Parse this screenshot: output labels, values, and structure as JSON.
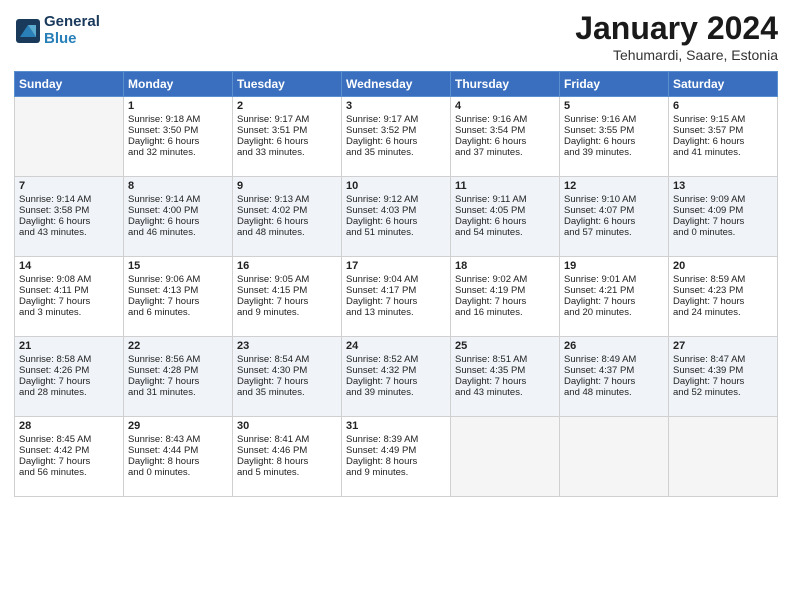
{
  "header": {
    "logo_line1": "General",
    "logo_line2": "Blue",
    "month_title": "January 2024",
    "location": "Tehumardi, Saare, Estonia"
  },
  "days_of_week": [
    "Sunday",
    "Monday",
    "Tuesday",
    "Wednesday",
    "Thursday",
    "Friday",
    "Saturday"
  ],
  "weeks": [
    [
      {
        "day": "",
        "empty": true
      },
      {
        "day": "1",
        "sunrise": "Sunrise: 9:18 AM",
        "sunset": "Sunset: 3:50 PM",
        "daylight": "Daylight: 6 hours",
        "minutes": "and 32 minutes."
      },
      {
        "day": "2",
        "sunrise": "Sunrise: 9:17 AM",
        "sunset": "Sunset: 3:51 PM",
        "daylight": "Daylight: 6 hours",
        "minutes": "and 33 minutes."
      },
      {
        "day": "3",
        "sunrise": "Sunrise: 9:17 AM",
        "sunset": "Sunset: 3:52 PM",
        "daylight": "Daylight: 6 hours",
        "minutes": "and 35 minutes."
      },
      {
        "day": "4",
        "sunrise": "Sunrise: 9:16 AM",
        "sunset": "Sunset: 3:54 PM",
        "daylight": "Daylight: 6 hours",
        "minutes": "and 37 minutes."
      },
      {
        "day": "5",
        "sunrise": "Sunrise: 9:16 AM",
        "sunset": "Sunset: 3:55 PM",
        "daylight": "Daylight: 6 hours",
        "minutes": "and 39 minutes."
      },
      {
        "day": "6",
        "sunrise": "Sunrise: 9:15 AM",
        "sunset": "Sunset: 3:57 PM",
        "daylight": "Daylight: 6 hours",
        "minutes": "and 41 minutes."
      }
    ],
    [
      {
        "day": "7",
        "sunrise": "Sunrise: 9:14 AM",
        "sunset": "Sunset: 3:58 PM",
        "daylight": "Daylight: 6 hours",
        "minutes": "and 43 minutes."
      },
      {
        "day": "8",
        "sunrise": "Sunrise: 9:14 AM",
        "sunset": "Sunset: 4:00 PM",
        "daylight": "Daylight: 6 hours",
        "minutes": "and 46 minutes."
      },
      {
        "day": "9",
        "sunrise": "Sunrise: 9:13 AM",
        "sunset": "Sunset: 4:02 PM",
        "daylight": "Daylight: 6 hours",
        "minutes": "and 48 minutes."
      },
      {
        "day": "10",
        "sunrise": "Sunrise: 9:12 AM",
        "sunset": "Sunset: 4:03 PM",
        "daylight": "Daylight: 6 hours",
        "minutes": "and 51 minutes."
      },
      {
        "day": "11",
        "sunrise": "Sunrise: 9:11 AM",
        "sunset": "Sunset: 4:05 PM",
        "daylight": "Daylight: 6 hours",
        "minutes": "and 54 minutes."
      },
      {
        "day": "12",
        "sunrise": "Sunrise: 9:10 AM",
        "sunset": "Sunset: 4:07 PM",
        "daylight": "Daylight: 6 hours",
        "minutes": "and 57 minutes."
      },
      {
        "day": "13",
        "sunrise": "Sunrise: 9:09 AM",
        "sunset": "Sunset: 4:09 PM",
        "daylight": "Daylight: 7 hours",
        "minutes": "and 0 minutes."
      }
    ],
    [
      {
        "day": "14",
        "sunrise": "Sunrise: 9:08 AM",
        "sunset": "Sunset: 4:11 PM",
        "daylight": "Daylight: 7 hours",
        "minutes": "and 3 minutes."
      },
      {
        "day": "15",
        "sunrise": "Sunrise: 9:06 AM",
        "sunset": "Sunset: 4:13 PM",
        "daylight": "Daylight: 7 hours",
        "minutes": "and 6 minutes."
      },
      {
        "day": "16",
        "sunrise": "Sunrise: 9:05 AM",
        "sunset": "Sunset: 4:15 PM",
        "daylight": "Daylight: 7 hours",
        "minutes": "and 9 minutes."
      },
      {
        "day": "17",
        "sunrise": "Sunrise: 9:04 AM",
        "sunset": "Sunset: 4:17 PM",
        "daylight": "Daylight: 7 hours",
        "minutes": "and 13 minutes."
      },
      {
        "day": "18",
        "sunrise": "Sunrise: 9:02 AM",
        "sunset": "Sunset: 4:19 PM",
        "daylight": "Daylight: 7 hours",
        "minutes": "and 16 minutes."
      },
      {
        "day": "19",
        "sunrise": "Sunrise: 9:01 AM",
        "sunset": "Sunset: 4:21 PM",
        "daylight": "Daylight: 7 hours",
        "minutes": "and 20 minutes."
      },
      {
        "day": "20",
        "sunrise": "Sunrise: 8:59 AM",
        "sunset": "Sunset: 4:23 PM",
        "daylight": "Daylight: 7 hours",
        "minutes": "and 24 minutes."
      }
    ],
    [
      {
        "day": "21",
        "sunrise": "Sunrise: 8:58 AM",
        "sunset": "Sunset: 4:26 PM",
        "daylight": "Daylight: 7 hours",
        "minutes": "and 28 minutes."
      },
      {
        "day": "22",
        "sunrise": "Sunrise: 8:56 AM",
        "sunset": "Sunset: 4:28 PM",
        "daylight": "Daylight: 7 hours",
        "minutes": "and 31 minutes."
      },
      {
        "day": "23",
        "sunrise": "Sunrise: 8:54 AM",
        "sunset": "Sunset: 4:30 PM",
        "daylight": "Daylight: 7 hours",
        "minutes": "and 35 minutes."
      },
      {
        "day": "24",
        "sunrise": "Sunrise: 8:52 AM",
        "sunset": "Sunset: 4:32 PM",
        "daylight": "Daylight: 7 hours",
        "minutes": "and 39 minutes."
      },
      {
        "day": "25",
        "sunrise": "Sunrise: 8:51 AM",
        "sunset": "Sunset: 4:35 PM",
        "daylight": "Daylight: 7 hours",
        "minutes": "and 43 minutes."
      },
      {
        "day": "26",
        "sunrise": "Sunrise: 8:49 AM",
        "sunset": "Sunset: 4:37 PM",
        "daylight": "Daylight: 7 hours",
        "minutes": "and 48 minutes."
      },
      {
        "day": "27",
        "sunrise": "Sunrise: 8:47 AM",
        "sunset": "Sunset: 4:39 PM",
        "daylight": "Daylight: 7 hours",
        "minutes": "and 52 minutes."
      }
    ],
    [
      {
        "day": "28",
        "sunrise": "Sunrise: 8:45 AM",
        "sunset": "Sunset: 4:42 PM",
        "daylight": "Daylight: 7 hours",
        "minutes": "and 56 minutes."
      },
      {
        "day": "29",
        "sunrise": "Sunrise: 8:43 AM",
        "sunset": "Sunset: 4:44 PM",
        "daylight": "Daylight: 8 hours",
        "minutes": "and 0 minutes."
      },
      {
        "day": "30",
        "sunrise": "Sunrise: 8:41 AM",
        "sunset": "Sunset: 4:46 PM",
        "daylight": "Daylight: 8 hours",
        "minutes": "and 5 minutes."
      },
      {
        "day": "31",
        "sunrise": "Sunrise: 8:39 AM",
        "sunset": "Sunset: 4:49 PM",
        "daylight": "Daylight: 8 hours",
        "minutes": "and 9 minutes."
      },
      {
        "day": "",
        "empty": true
      },
      {
        "day": "",
        "empty": true
      },
      {
        "day": "",
        "empty": true
      }
    ]
  ]
}
